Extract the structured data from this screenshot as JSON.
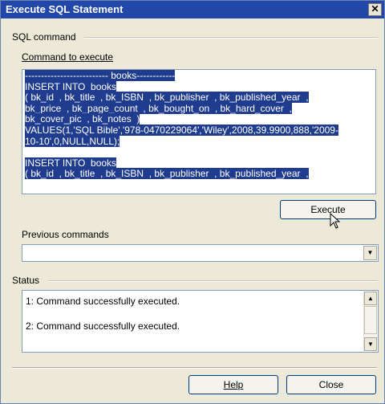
{
  "window": {
    "title": "Execute SQL Statement",
    "close_glyph": "✕"
  },
  "sql_group": {
    "label": "SQL command"
  },
  "command": {
    "label": "Command to execute",
    "lines": [
      "-------------------------- books------------",
      "INSERT INTO  books",
      "( bk_id  , bk_title  , bk_ISBN  , bk_publisher  , bk_published_year  ,",
      "bk_price  , bk_page_count  , bk_bought_on  , bk_hard_cover  ,",
      "bk_cover_pic  , bk_notes  )",
      "VALUES(1,'SQL Bible','978-0470229064','Wiley',2008,39.9900,888,'2009-",
      "10-10',0,NULL,NULL);",
      "",
      "INSERT INTO  books",
      "( bk_id  , bk_title  , bk_ISBN  , bk_publisher  , bk_published_year  ,"
    ]
  },
  "buttons": {
    "execute": "Execute",
    "help": "Help",
    "close": "Close"
  },
  "previous": {
    "label": "Previous commands",
    "value": ""
  },
  "status": {
    "label": "Status",
    "lines": [
      "1: Command successfully executed.",
      "2: Command successfully executed."
    ]
  },
  "icons": {
    "dropdown": "chevron-down-icon",
    "scroll_up": "arrow-up-icon",
    "scroll_down": "arrow-down-icon"
  },
  "colors": {
    "selection": "#1f3c8e",
    "titlebar": "#2147a8",
    "background": "#ece9d8"
  }
}
